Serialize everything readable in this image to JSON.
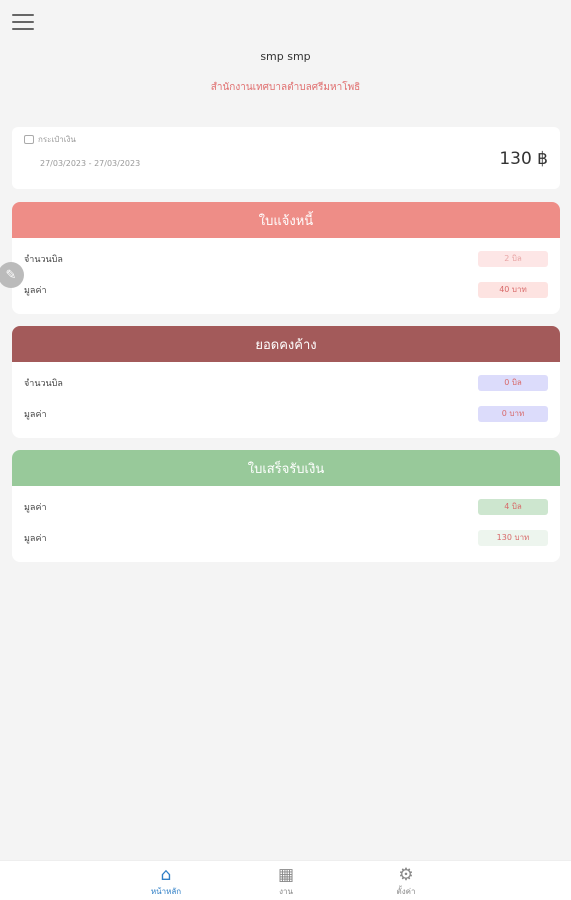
{
  "header": {
    "user_name": "smp smp",
    "organization": "สำนักงานเทศบาลตำบลศรีมหาโพธิ"
  },
  "wallet": {
    "label": "กระเป๋าเงิน",
    "date_range": "27/03/2023 - 27/03/2023",
    "total": "130 ฿"
  },
  "sections": {
    "invoice": {
      "title": "ใบแจ้งหนี้",
      "color": "#ee8d87",
      "rows": [
        {
          "label": "จำนวนบิล",
          "value": "2 บิล",
          "badge_bg": "#fde6e6",
          "badge_fg": "#e8a6a6"
        },
        {
          "label": "มูลค่า",
          "value": "40 บาท",
          "badge_bg": "#fde3e1",
          "badge_fg": "#d86a6a"
        }
      ]
    },
    "outstanding": {
      "title": "ยอดคงค้าง",
      "color": "#a35a5a",
      "rows": [
        {
          "label": "จำนวนบิล",
          "value": "0 บิล",
          "badge_bg": "#dcdcfb",
          "badge_fg": "#d86a6a"
        },
        {
          "label": "มูลค่า",
          "value": "0 บาท",
          "badge_bg": "#dcdcfb",
          "badge_fg": "#d86a6a"
        }
      ]
    },
    "receipt": {
      "title": "ใบเสร็จรับเงิน",
      "color": "#98c99a",
      "rows": [
        {
          "label": "มูลค่า",
          "value": "4 บิล",
          "badge_bg": "#cde6cf",
          "badge_fg": "#d86a6a"
        },
        {
          "label": "มูลค่า",
          "value": "130 บาท",
          "badge_bg": "#edf5ee",
          "badge_fg": "#d86a6a"
        }
      ]
    }
  },
  "nav": {
    "home_label": "หน้าหลัก",
    "work_label": "งาน",
    "settings_label": "ตั้งค่า",
    "active_color": "#2f7fc6"
  }
}
